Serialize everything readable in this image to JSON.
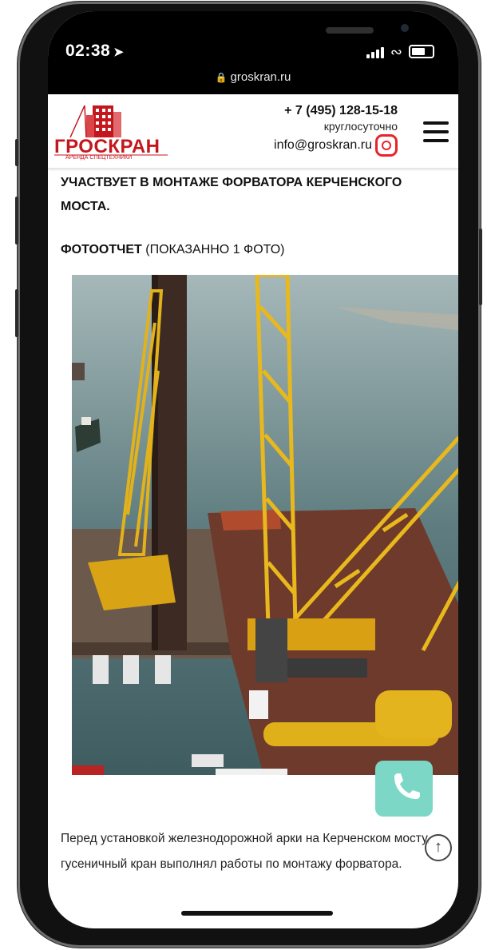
{
  "status": {
    "time": "02:38",
    "url": "groskran.ru"
  },
  "header": {
    "logo_text": "ГРОСКРАН",
    "logo_sub": "АРЕНДА СПЕЦТЕХНИКИ",
    "phone": "+ 7 (495) 128-15-18",
    "hours": "круглосуточно",
    "email": "info@groskran.ru"
  },
  "article": {
    "heading": "УЧАСТВУЕТ В МОНТАЖЕ ФОРВАТОРА КЕРЧЕНСКОГО МОСТА.",
    "report_label": "ФОТООТЧЕТ",
    "report_count": " (ПОКАЗАННО 1 ФОТО)",
    "caption": "Перед установкой железнодорожной арки на Керченском мосту, гусеничный кран выполнял работы по монтажу форватора."
  },
  "colors": {
    "brand_red": "#c4171d",
    "call_button": "#7dd7c6",
    "instagram": "#e8232b"
  },
  "icons": {
    "location": "location-arrow-icon",
    "lock": "lock-icon",
    "menu": "hamburger-icon",
    "call": "phone-icon",
    "scroll_up": "arrow-up-icon"
  }
}
